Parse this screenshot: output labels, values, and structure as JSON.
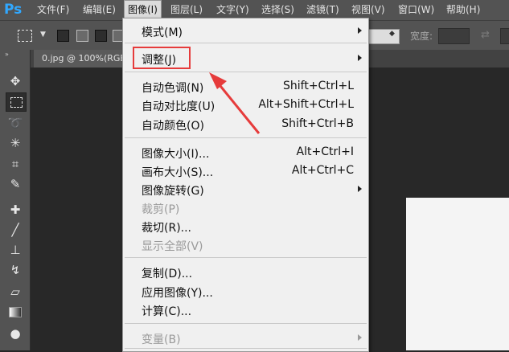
{
  "app": {
    "logo": "Ps"
  },
  "menubar": {
    "items": [
      {
        "label": "文件(F)"
      },
      {
        "label": "编辑(E)"
      },
      {
        "label": "图像(I)"
      },
      {
        "label": "图层(L)"
      },
      {
        "label": "文字(Y)"
      },
      {
        "label": "选择(S)"
      },
      {
        "label": "滤镜(T)"
      },
      {
        "label": "视图(V)"
      },
      {
        "label": "窗口(W)"
      },
      {
        "label": "帮助(H)"
      }
    ]
  },
  "options": {
    "width_label": "宽度:"
  },
  "document": {
    "tab_label": "0.jpg @ 100%(RGB"
  },
  "image_menu": {
    "items": [
      {
        "label": "模式(M)",
        "shortcut": "",
        "submenu": true,
        "disabled": false
      },
      {
        "label": "调整(J)",
        "shortcut": "",
        "submenu": true,
        "disabled": false
      },
      {
        "label": "自动色调(N)",
        "shortcut": "Shift+Ctrl+L",
        "submenu": false,
        "disabled": false
      },
      {
        "label": "自动对比度(U)",
        "shortcut": "Alt+Shift+Ctrl+L",
        "submenu": false,
        "disabled": false
      },
      {
        "label": "自动颜色(O)",
        "shortcut": "Shift+Ctrl+B",
        "submenu": false,
        "disabled": false
      },
      {
        "label": "图像大小(I)...",
        "shortcut": "Alt+Ctrl+I",
        "submenu": false,
        "disabled": false
      },
      {
        "label": "画布大小(S)...",
        "shortcut": "Alt+Ctrl+C",
        "submenu": false,
        "disabled": false
      },
      {
        "label": "图像旋转(G)",
        "shortcut": "",
        "submenu": true,
        "disabled": false
      },
      {
        "label": "裁剪(P)",
        "shortcut": "",
        "submenu": false,
        "disabled": true
      },
      {
        "label": "裁切(R)...",
        "shortcut": "",
        "submenu": false,
        "disabled": false
      },
      {
        "label": "显示全部(V)",
        "shortcut": "",
        "submenu": false,
        "disabled": true
      },
      {
        "label": "复制(D)...",
        "shortcut": "",
        "submenu": false,
        "disabled": false
      },
      {
        "label": "应用图像(Y)...",
        "shortcut": "",
        "submenu": false,
        "disabled": false
      },
      {
        "label": "计算(C)...",
        "shortcut": "",
        "submenu": false,
        "disabled": false
      },
      {
        "label": "变量(B)",
        "shortcut": "",
        "submenu": true,
        "disabled": true
      }
    ]
  },
  "colors": {
    "highlight": "#e63b3b",
    "menu_bg": "#f0f0f0",
    "chrome": "#535353"
  },
  "icons": {
    "tools": [
      "move-icon",
      "marquee-icon",
      "lasso-icon",
      "magic-wand-icon",
      "crop-icon",
      "eyedropper-icon",
      "healing-brush-icon",
      "brush-icon",
      "stamp-icon",
      "history-brush-icon",
      "eraser-icon",
      "gradient-icon",
      "blur-icon"
    ]
  }
}
